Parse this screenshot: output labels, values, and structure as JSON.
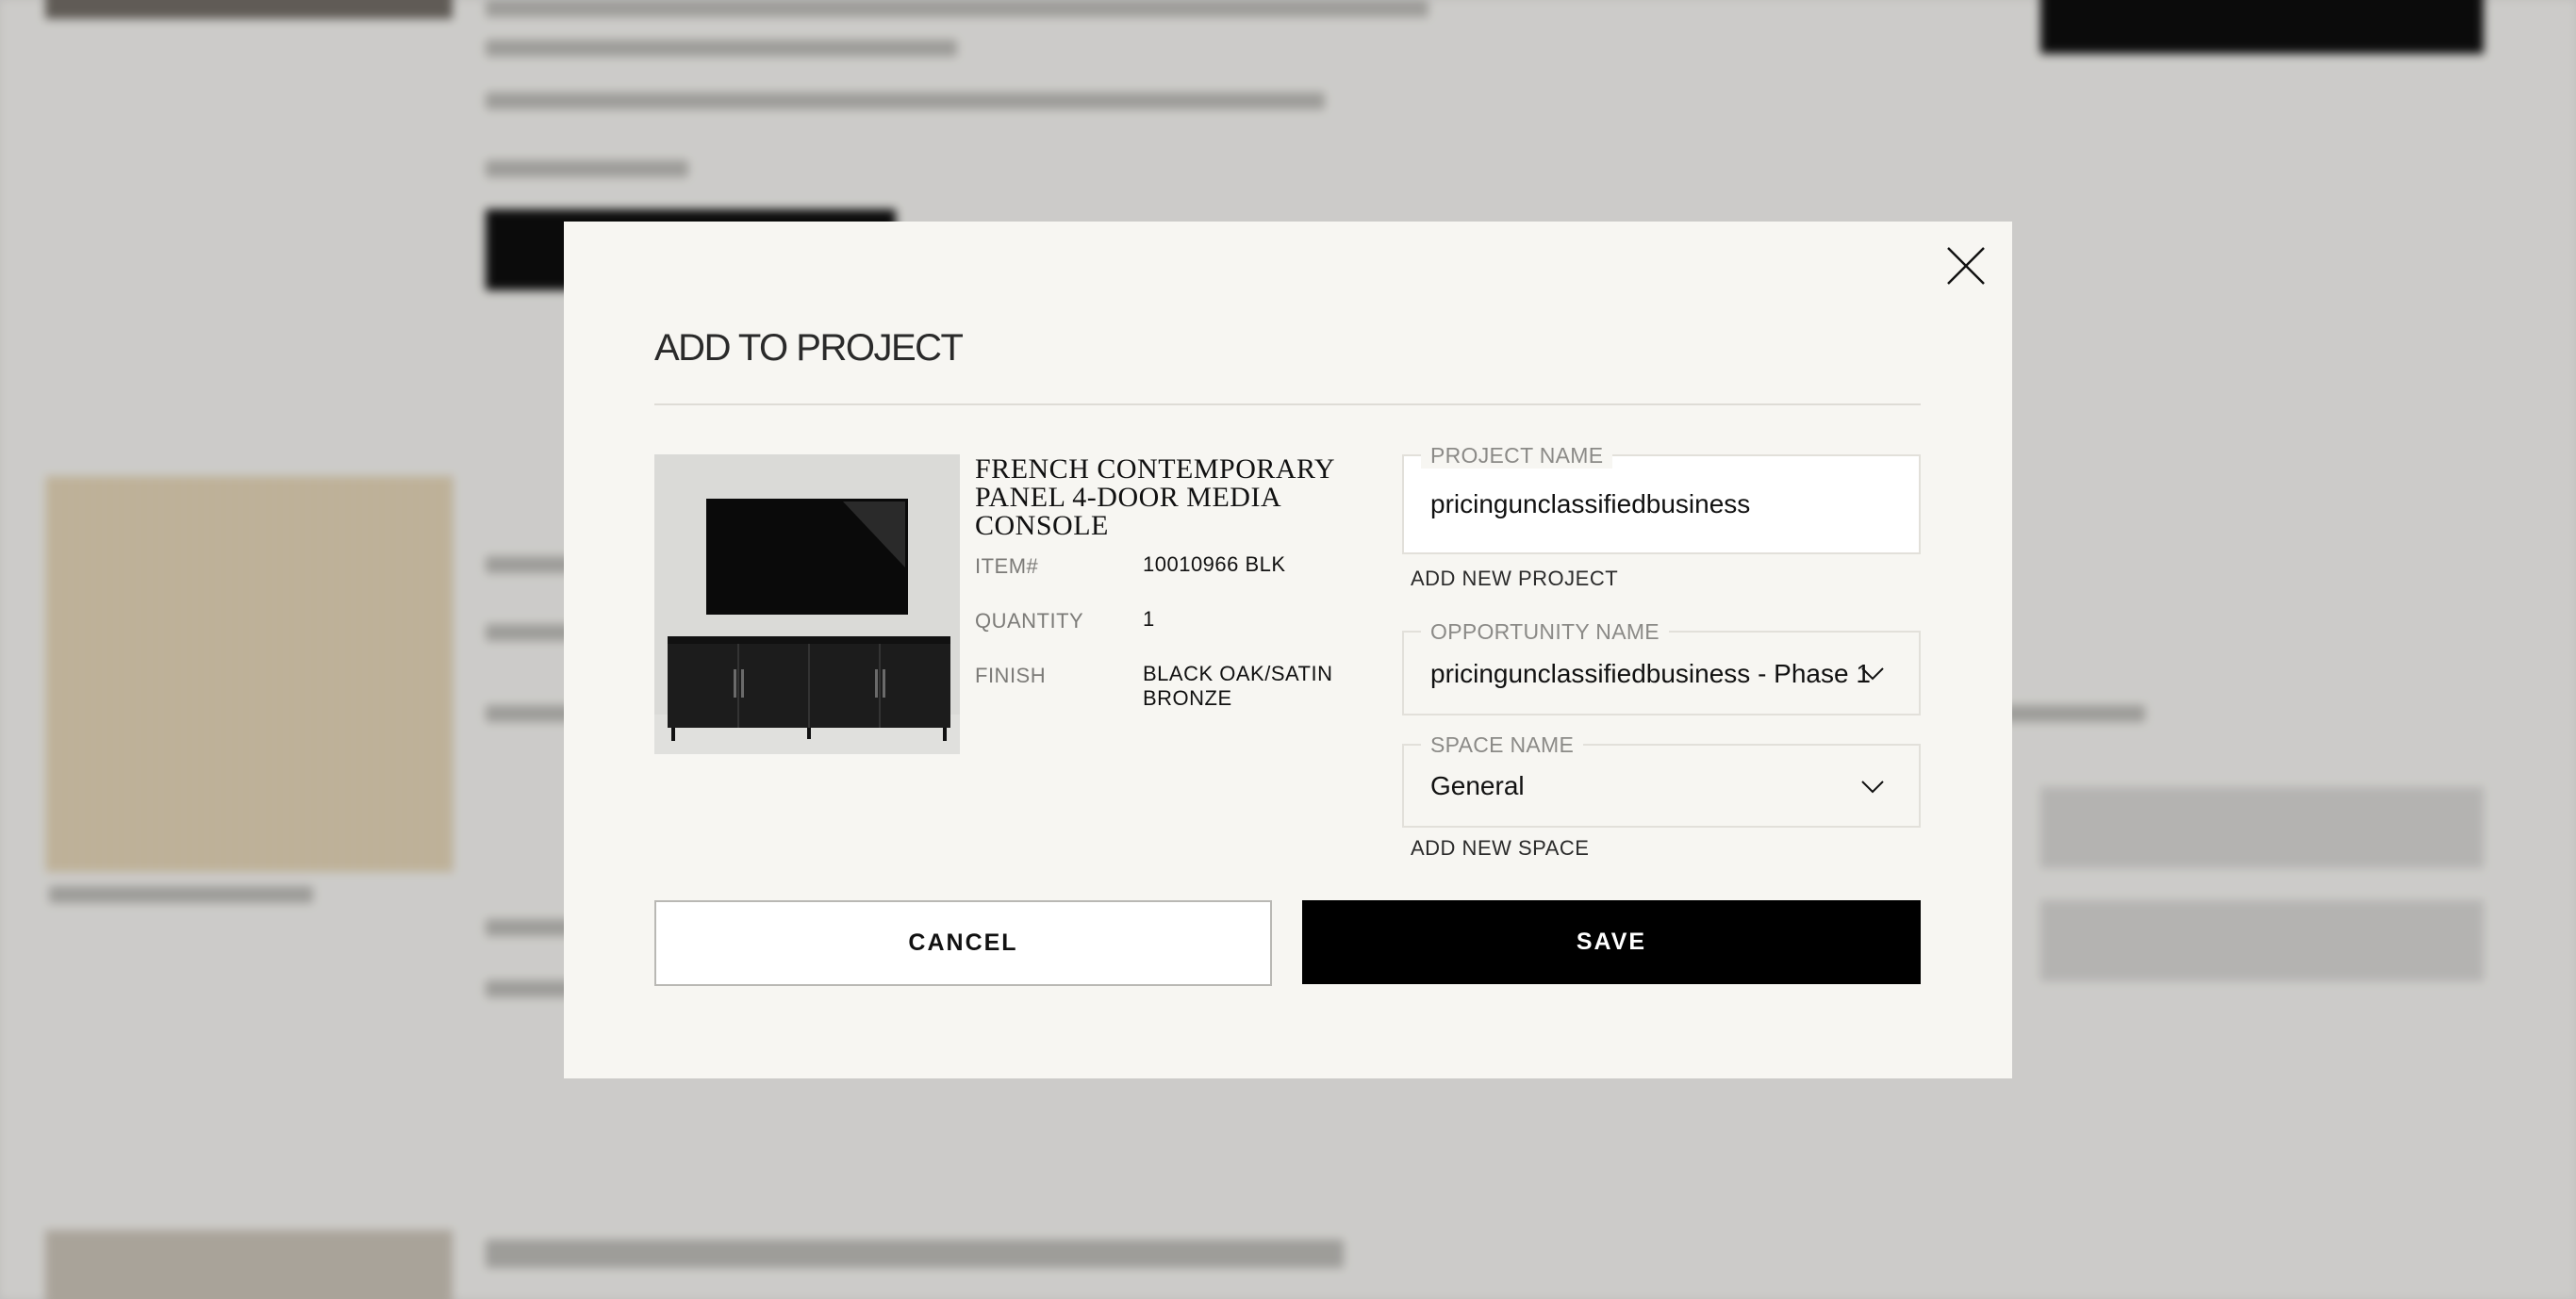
{
  "modal": {
    "title": "ADD TO PROJECT",
    "product": {
      "name": "FRENCH CONTEMPORARY PANEL 4-DOOR MEDIA CONSOLE",
      "item_label": "ITEM#",
      "item_value": "10010966 BLK",
      "quantity_label": "QUANTITY",
      "quantity_value": "1",
      "finish_label": "FINISH",
      "finish_value": "BLACK OAK/SATIN BRONZE"
    },
    "project_name": {
      "label": "PROJECT NAME",
      "value": "pricingunclassifiedbusiness"
    },
    "add_project_link": "ADD NEW PROJECT",
    "opportunity_name": {
      "label": "OPPORTUNITY NAME",
      "selected": "pricingunclassifiedbusiness - Phase 1"
    },
    "space_name": {
      "label": "SPACE NAME",
      "selected": "General"
    },
    "add_space_link": "ADD NEW SPACE",
    "cancel_label": "CANCEL",
    "save_label": "SAVE"
  },
  "icons": {
    "close": "close-icon",
    "chevron": "chevron-down-icon"
  },
  "colors": {
    "modal_bg": "#f7f6f2",
    "primary_button": "#000000",
    "overlay": "#d6d5d3"
  }
}
